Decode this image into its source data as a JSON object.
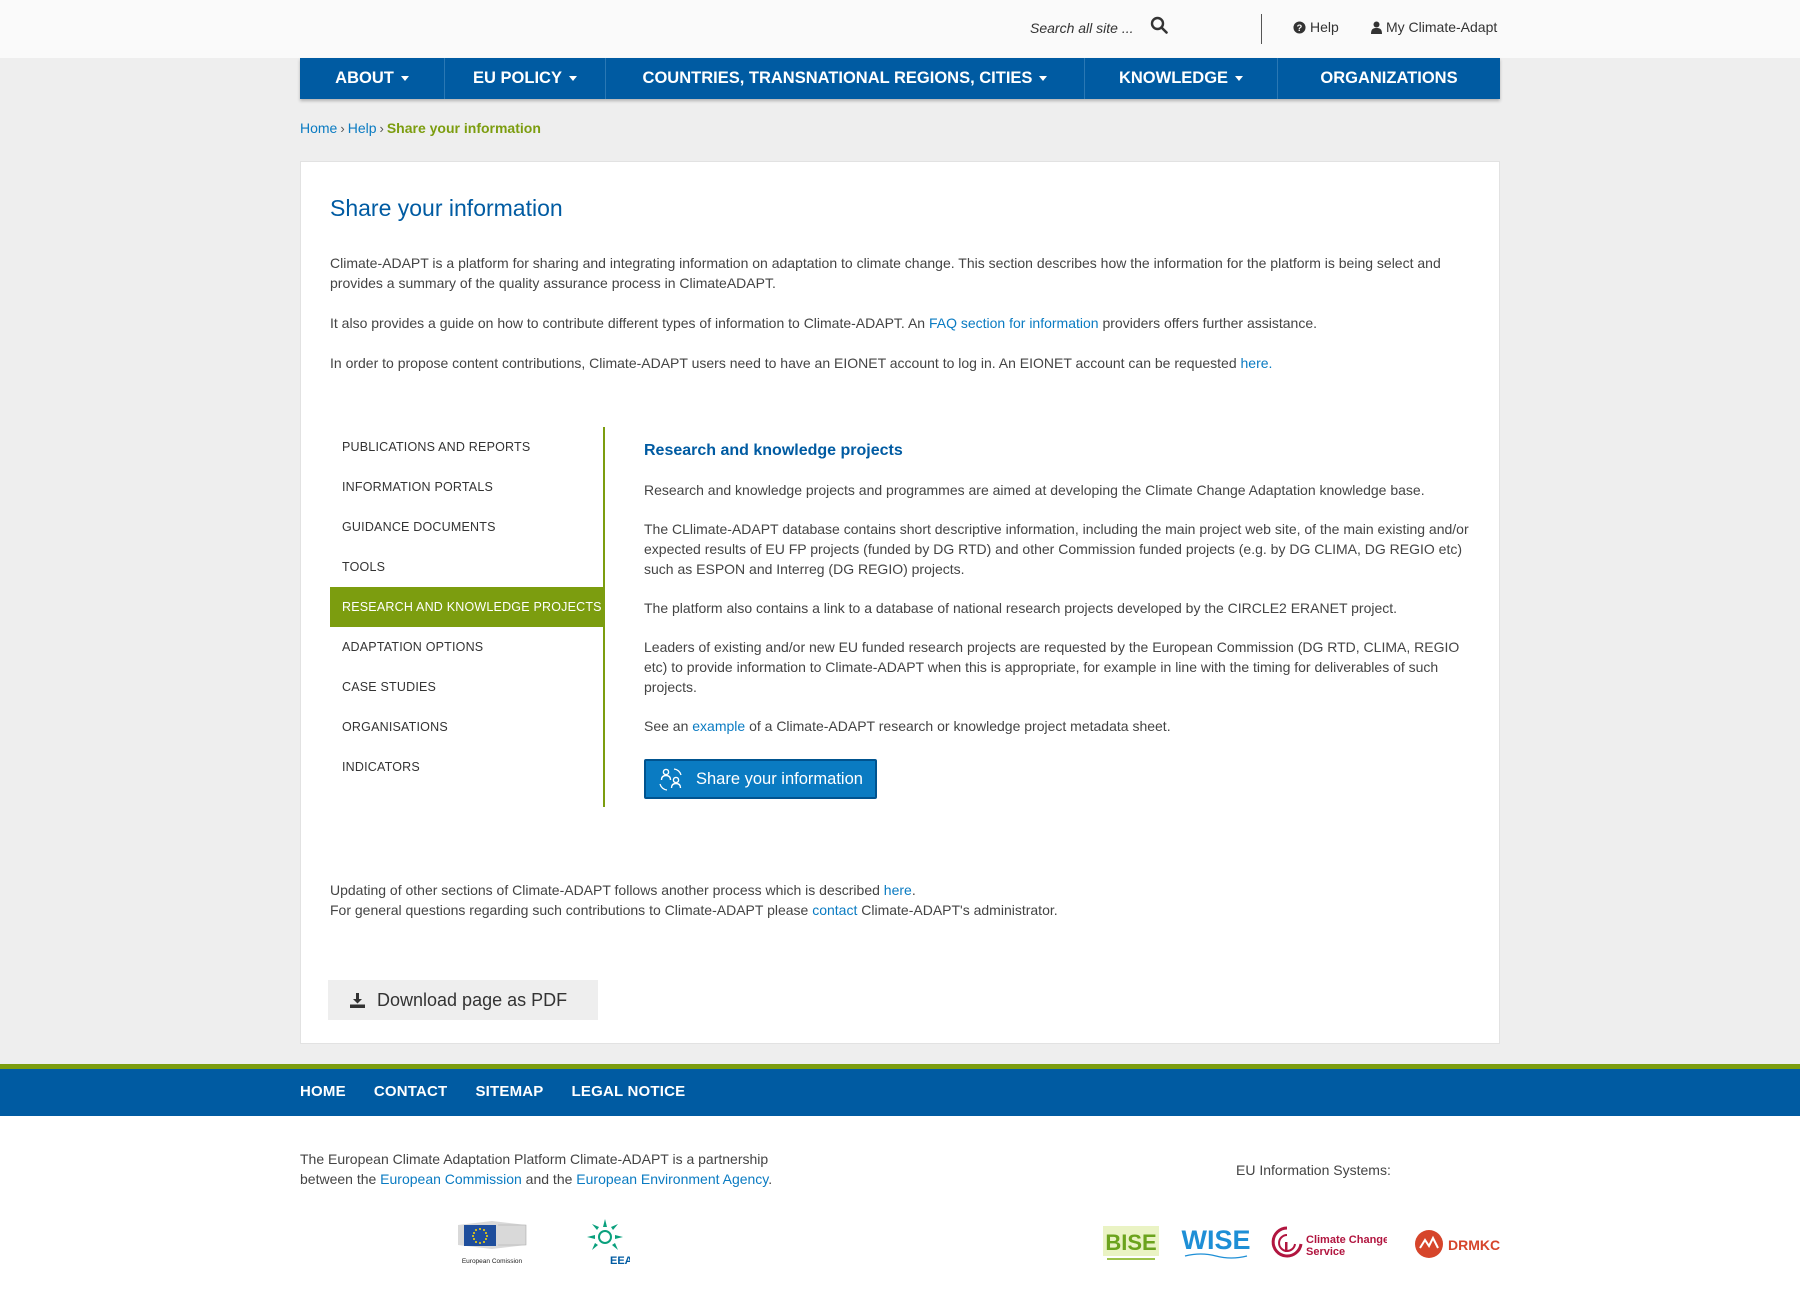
{
  "header": {
    "search_placeholder": "Search all site ...",
    "help": "Help",
    "my_account": "My Climate-Adapt"
  },
  "nav": [
    {
      "label": "ABOUT",
      "dropdown": true
    },
    {
      "label": "EU POLICY",
      "dropdown": true
    },
    {
      "label": "COUNTRIES, TRANSNATIONAL REGIONS, CITIES",
      "dropdown": true
    },
    {
      "label": "KNOWLEDGE",
      "dropdown": true
    },
    {
      "label": "ORGANIZATIONS",
      "dropdown": false
    }
  ],
  "breadcrumb": {
    "home": "Home",
    "help": "Help",
    "current": "Share your information"
  },
  "page": {
    "title": "Share your information",
    "intro1": "Climate-ADAPT is a platform for sharing and integrating information on adaptation to climate change. This section describes how the information for the platform is being select and provides a summary of the quality assurance process in ClimateADAPT.",
    "intro2_pre": "It also provides a guide on how to contribute different types of information to Climate-ADAPT. An ",
    "intro2_link": "FAQ section for information",
    "intro2_post": " providers offers further assistance.",
    "intro3_pre": "In order to propose content contributions, Climate-ADAPT users need to have an EIONET account to log in. An EIONET account can be requested ",
    "intro3_link": "here."
  },
  "sidebar": [
    {
      "label": "PUBLICATIONS AND REPORTS",
      "active": false
    },
    {
      "label": "INFORMATION PORTALS",
      "active": false
    },
    {
      "label": "GUIDANCE DOCUMENTS",
      "active": false
    },
    {
      "label": "TOOLS",
      "active": false
    },
    {
      "label": "RESEARCH AND KNOWLEDGE PROJECTS",
      "active": true
    },
    {
      "label": "ADAPTATION OPTIONS",
      "active": false
    },
    {
      "label": "CASE STUDIES",
      "active": false
    },
    {
      "label": "ORGANISATIONS",
      "active": false
    },
    {
      "label": "INDICATORS",
      "active": false
    }
  ],
  "content": {
    "heading": "Research and knowledge projects",
    "p1": "Research and knowledge projects and programmes are aimed at developing the Climate Change Adaptation knowledge base.",
    "p2": "The CLlimate-ADAPT database contains short descriptive information, including the main project web site, of the main existing and/or expected results of EU FP projects (funded by DG RTD) and other Commission funded projects (e.g. by DG CLIMA, DG REGIO etc) such as ESPON and Interreg (DG REGIO) projects.",
    "p3": "The platform also contains a link to a database of national research projects developed by the CIRCLE2 ERANET project.",
    "p4": "Leaders of existing and/or new EU funded research projects are requested by the European Commission (DG RTD, CLIMA, REGIO etc) to provide information to Climate-ADAPT when this is appropriate, for example in line with the timing for deliverables of such projects.",
    "p5_pre": "See an ",
    "p5_link": "example",
    "p5_post": " of a Climate-ADAPT research or knowledge project metadata sheet.",
    "share_button": "Share your information"
  },
  "footer_text": {
    "l1_pre": "Updating of other sections of Climate-ADAPT follows another process which is described ",
    "l1_link": "here",
    "l1_post": ".",
    "l2_pre": "For general questions regarding such contributions to Climate-ADAPT please ",
    "l2_link": "contact",
    "l2_post": " Climate-ADAPT's administrator."
  },
  "pdf_button": "Download page as PDF",
  "footer_nav": [
    "HOME",
    "CONTACT",
    "SITEMAP",
    "LEGAL NOTICE"
  ],
  "partner": {
    "l1": "The European Climate Adaptation Platform Climate-ADAPT is a partnership",
    "l2_pre": "between the ",
    "ec_link": "European Commission",
    "l2_mid": " and the ",
    "eea_link": "European Environment Agency",
    "l2_post": "."
  },
  "eu_systems_label": "EU Information Systems:",
  "logos": {
    "ec_caption": "European Comission",
    "eea": "EEA",
    "bise": "BISE",
    "wise": "WISE",
    "copernicus_l1": "Climate Change",
    "copernicus_l2": "Service",
    "drmkc": "DRMKC"
  },
  "colors": {
    "brand_blue": "#005ba2",
    "accent_green": "#7c9d0f",
    "link_blue": "#0a7bc2"
  }
}
